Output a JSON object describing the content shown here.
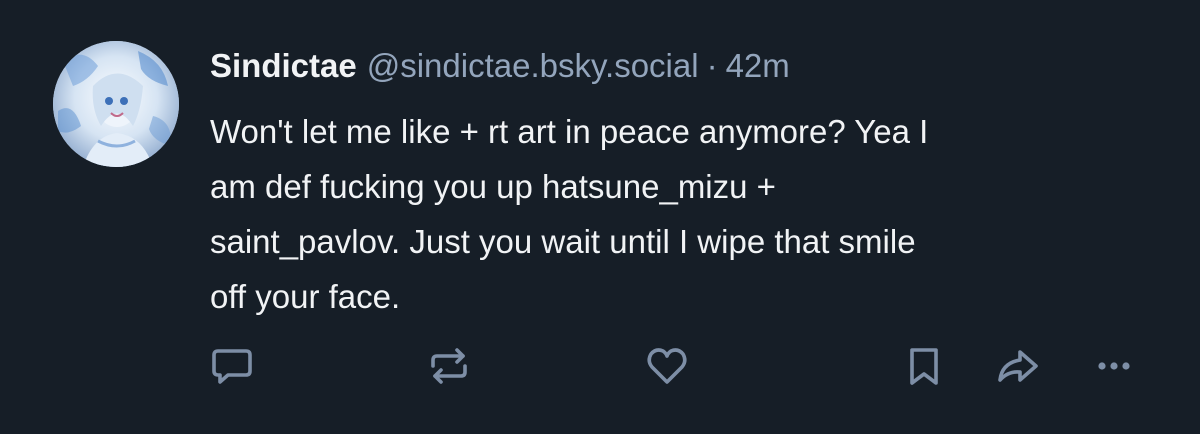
{
  "post": {
    "author_name": "Sindictae",
    "author_handle": "@sindictae.bsky.social",
    "separator": "·",
    "timestamp": "42m",
    "text_lines": [
      "Won't let me like + rt art in peace anymore? Yea I",
      "am def fucking you up hatsune_mizu +",
      "saint_pavlov. Just you wait until I wipe that smile",
      "off your face."
    ]
  },
  "actions": {
    "reply_icon": "speech-bubble-icon",
    "repost_icon": "repost-arrows-icon",
    "like_icon": "heart-icon",
    "bookmark_icon": "bookmark-icon",
    "share_icon": "share-arrow-icon",
    "more_icon": "ellipsis-icon"
  },
  "colors": {
    "background": "#161e27",
    "primary_text": "#f1f3f5",
    "secondary_text": "#93a5bc",
    "icon": "#7d8ea6"
  }
}
